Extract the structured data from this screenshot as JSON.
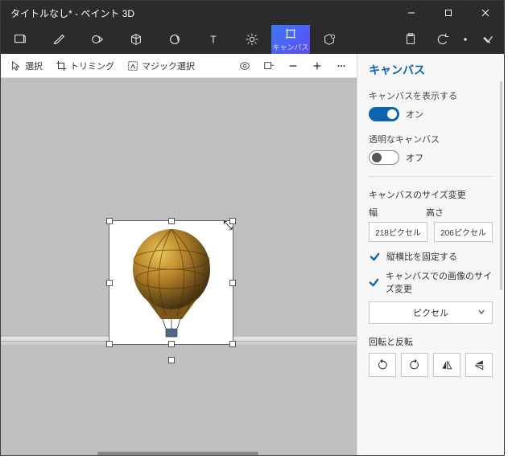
{
  "titlebar": {
    "title": "タイトルなし* - ペイント 3D"
  },
  "ribbon": {
    "active_label": "キャンバス"
  },
  "subbar": {
    "select": "選択",
    "trim": "トリミング",
    "magic": "マジック選択"
  },
  "panel": {
    "heading": "キャンバス",
    "show_canvas_label": "キャンバスを表示する",
    "show_canvas_state": "オン",
    "transparent_label": "透明なキャンバス",
    "transparent_state": "オフ",
    "resize_heading": "キャンバスのサイズ変更",
    "width_label": "幅",
    "height_label": "高さ",
    "width_value": "218ピクセル",
    "height_value": "206ピクセル",
    "lock_aspect": "縦横比を固定する",
    "resize_image": "キャンバスでの画像のサイズ変更",
    "unit": "ピクセル",
    "rotate_heading": "回転と反転"
  }
}
